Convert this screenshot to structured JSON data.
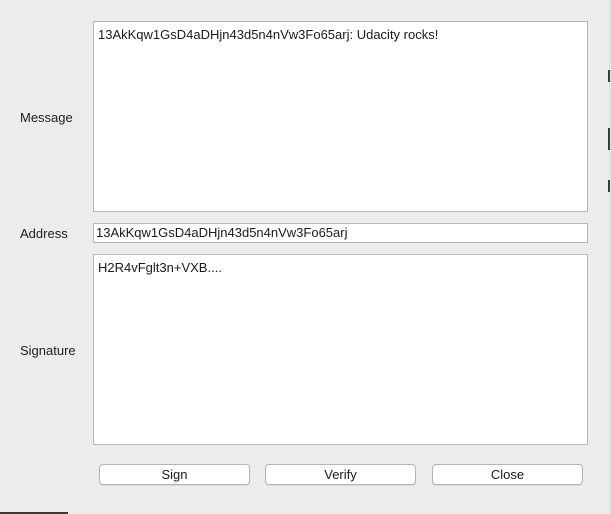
{
  "form": {
    "message_label": "Message",
    "message_value": "13AkKqw1GsD4aDHjn43d5n4nVw3Fo65arj: Udacity rocks!",
    "address_label": "Address",
    "address_value": "13AkKqw1GsD4aDHjn43d5n4nVw3Fo65arj",
    "signature_label": "Signature",
    "signature_value": "H2R4vFglt3n+VXB...."
  },
  "buttons": {
    "sign_label": "Sign",
    "verify_label": "Verify",
    "close_label": "Close"
  }
}
